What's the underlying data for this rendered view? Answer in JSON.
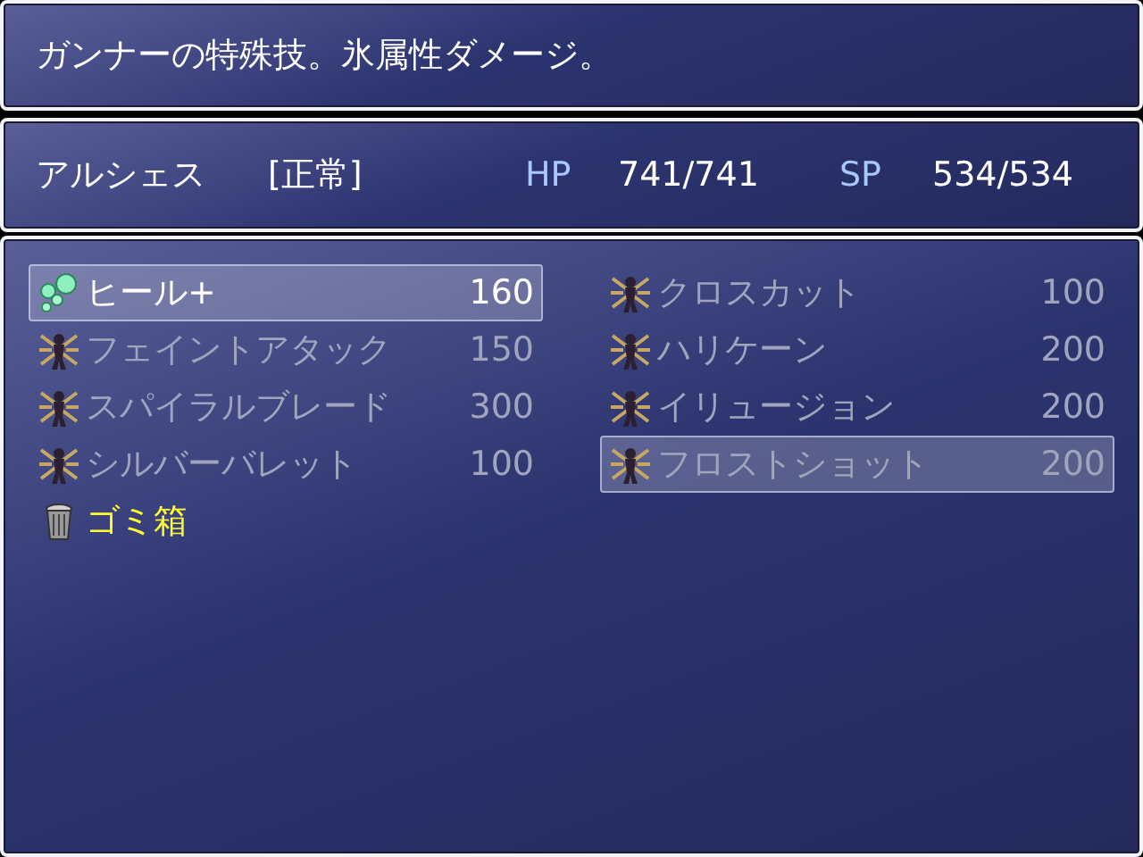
{
  "help": {
    "text": "ガンナーの特殊技。氷属性ダメージ。"
  },
  "status": {
    "name": "アルシェス",
    "state": "[正常]",
    "hp_label": "HP",
    "hp": "741/741",
    "sp_label": "SP",
    "sp": "534/534"
  },
  "skills": [
    {
      "kind": "heal",
      "name": "ヒール+",
      "cost": "160",
      "disabled": false,
      "selected": true
    },
    {
      "kind": "skill",
      "name": "クロスカット",
      "cost": "100",
      "disabled": true,
      "selected": false
    },
    {
      "kind": "skill",
      "name": "フェイントアタック",
      "cost": "150",
      "disabled": true,
      "selected": false
    },
    {
      "kind": "skill",
      "name": "ハリケーン",
      "cost": "200",
      "disabled": true,
      "selected": false
    },
    {
      "kind": "skill",
      "name": "スパイラルブレード",
      "cost": "300",
      "disabled": true,
      "selected": false
    },
    {
      "kind": "skill",
      "name": "イリュージョン",
      "cost": "200",
      "disabled": true,
      "selected": false
    },
    {
      "kind": "skill",
      "name": "シルバーバレット",
      "cost": "100",
      "disabled": true,
      "selected": false
    },
    {
      "kind": "skill",
      "name": "フロストショット",
      "cost": "200",
      "disabled": true,
      "selected": true
    },
    {
      "kind": "trash",
      "name": "ゴミ箱",
      "selected": false
    }
  ]
}
